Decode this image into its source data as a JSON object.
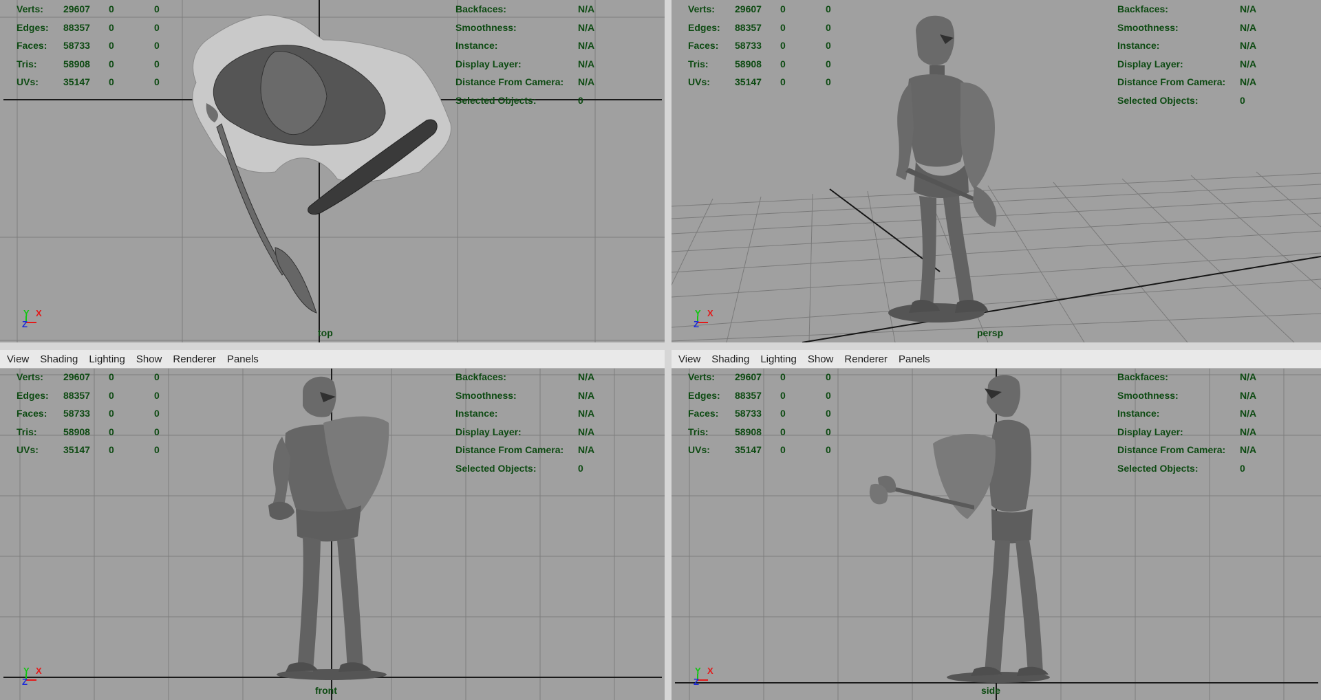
{
  "menu": [
    "View",
    "Shading",
    "Lighting",
    "Show",
    "Renderer",
    "Panels"
  ],
  "hud_left": [
    {
      "label": "Verts:",
      "v1": "29607",
      "v2": "0",
      "v3": "0"
    },
    {
      "label": "Edges:",
      "v1": "88357",
      "v2": "0",
      "v3": "0"
    },
    {
      "label": "Faces:",
      "v1": "58733",
      "v2": "0",
      "v3": "0"
    },
    {
      "label": "Tris:",
      "v1": "58908",
      "v2": "0",
      "v3": "0"
    },
    {
      "label": "UVs:",
      "v1": "35147",
      "v2": "0",
      "v3": "0"
    }
  ],
  "hud_right": [
    {
      "label": "Backfaces:",
      "value": "N/A"
    },
    {
      "label": "Smoothness:",
      "value": "N/A"
    },
    {
      "label": "Instance:",
      "value": "N/A"
    },
    {
      "label": "Display Layer:",
      "value": "N/A"
    },
    {
      "label": "Distance From Camera:",
      "value": "N/A"
    },
    {
      "label": "Selected Objects:",
      "value": "0"
    }
  ],
  "viewports": {
    "top": {
      "camera": "top",
      "axes": [
        "Y",
        "X",
        "Z"
      ]
    },
    "persp": {
      "camera": "persp",
      "axes": [
        "Y",
        "X",
        "Z"
      ]
    },
    "front": {
      "camera": "front",
      "axes": [
        "Y",
        "X",
        "Z"
      ]
    },
    "side": {
      "camera": "side",
      "axes": [
        "Y",
        "X",
        "Z"
      ]
    }
  },
  "colors": {
    "viewport_bg": "#a0a0a0",
    "grid": "#7e7e7e",
    "grid_axis": "#1a1a1a",
    "hud_text": "#0d4a12",
    "model": "#5c5c5c",
    "active_border": "#a9c6ea"
  },
  "active_viewport": "side"
}
